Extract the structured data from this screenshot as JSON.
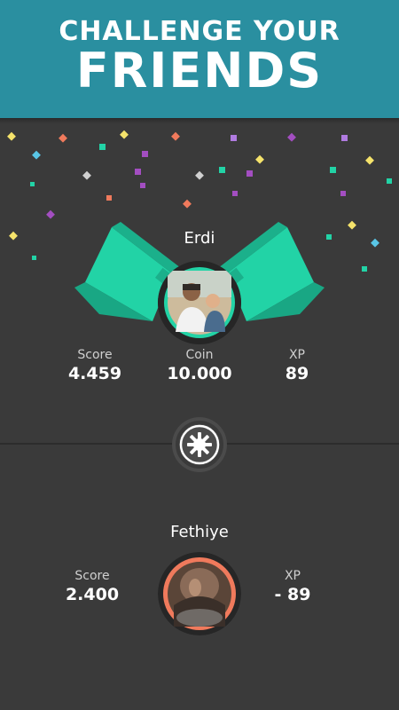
{
  "header": {
    "line1": "CHALLENGE YOUR",
    "line2": "FRIENDS"
  },
  "player1": {
    "name": "Erdi",
    "stats": [
      {
        "label": "Score",
        "value": "4.459"
      },
      {
        "label": "Coin",
        "value": "10.000"
      },
      {
        "label": "XP",
        "value": "89"
      }
    ]
  },
  "player2": {
    "name": "Fethiye",
    "stats": [
      {
        "label": "Score",
        "value": "2.400"
      },
      {
        "label": "XP",
        "value": "- 89"
      }
    ]
  },
  "colors": {
    "banner": "#2a8fa0",
    "background": "#3a3a3a",
    "flag": "#22d3a6",
    "ring": "#f07a5c"
  }
}
